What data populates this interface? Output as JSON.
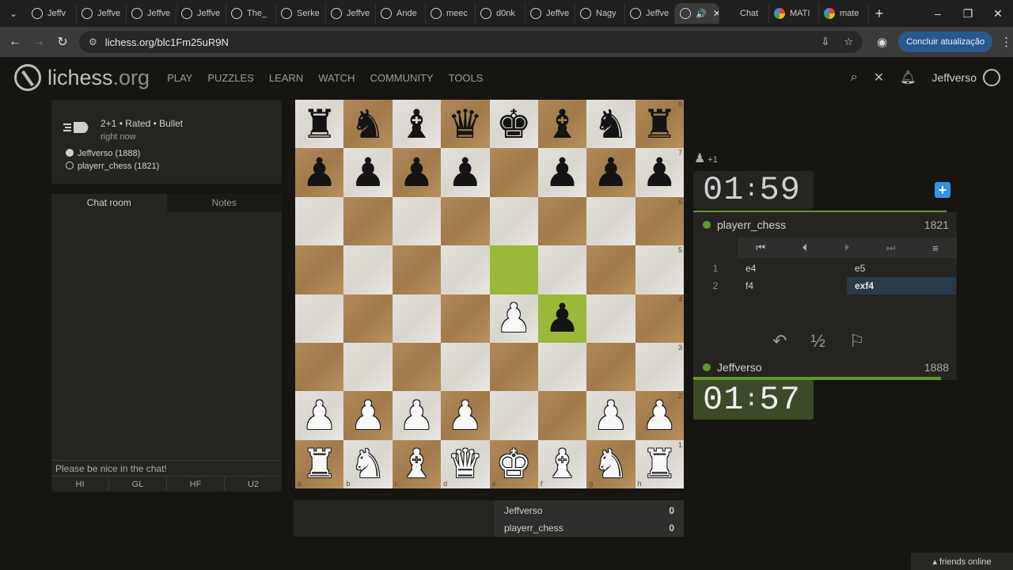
{
  "browser": {
    "tabs": [
      {
        "label": "Jeffv",
        "icon": "lichess-icon"
      },
      {
        "label": "Jeffve",
        "icon": "lichess-icon"
      },
      {
        "label": "Jeffve",
        "icon": "lichess-icon"
      },
      {
        "label": "Jeffve",
        "icon": "lichess-icon"
      },
      {
        "label": "The_",
        "icon": "lichess-icon"
      },
      {
        "label": "Serke",
        "icon": "lichess-icon"
      },
      {
        "label": "Jeffve",
        "icon": "lichess-icon"
      },
      {
        "label": "Ande",
        "icon": "lichess-icon"
      },
      {
        "label": "meec",
        "icon": "lichess-icon"
      },
      {
        "label": "d0nk",
        "icon": "lichess-icon"
      },
      {
        "label": "Jeffve",
        "icon": "lichess-icon"
      },
      {
        "label": "Nagy",
        "icon": "lichess-icon"
      },
      {
        "label": "Jeffve",
        "icon": "lichess-icon"
      }
    ],
    "extra_tabs": [
      {
        "label": "Chat",
        "icon": "chatgpt-icon"
      },
      {
        "label": "MATI",
        "icon": "google-icon"
      },
      {
        "label": "mate",
        "icon": "google-icon"
      }
    ],
    "url": "lichess.org/blc1Fm25uR9N",
    "update_label": "Concluir atualização"
  },
  "site": {
    "logo_main": "lichess",
    "logo_tld": ".org",
    "nav": [
      "PLAY",
      "PUZZLES",
      "LEARN",
      "WATCH",
      "COMMUNITY",
      "TOOLS"
    ],
    "username": "Jeffverso"
  },
  "game": {
    "mode": "2+1 • Rated • Bullet",
    "when": "right now",
    "white_player": "Jeffverso (1888)",
    "black_player": "playerr_chess (1821)"
  },
  "chat": {
    "tabs": [
      "Chat room",
      "Notes"
    ],
    "placeholder": "Please be nice in the chat!",
    "presets": [
      "HI",
      "GL",
      "HF",
      "U2"
    ]
  },
  "board": {
    "ranks": [
      "8",
      "7",
      "6",
      "5",
      "4",
      "3",
      "2",
      "1"
    ],
    "files": [
      "a",
      "b",
      "c",
      "d",
      "e",
      "f",
      "g",
      "h"
    ],
    "position": [
      [
        "r",
        "n",
        "b",
        "q",
        "k",
        "b",
        "n",
        "r"
      ],
      [
        "p",
        "p",
        "p",
        "p",
        "",
        "p",
        "p",
        "p"
      ],
      [
        "",
        "",
        "",
        "",
        "",
        "",
        "",
        ""
      ],
      [
        "",
        "",
        "",
        "",
        "",
        "",
        "",
        ""
      ],
      [
        "",
        "",
        "",
        "",
        "P",
        "p",
        "",
        ""
      ],
      [
        "",
        "",
        "",
        "",
        "",
        "",
        "",
        ""
      ],
      [
        "P",
        "P",
        "P",
        "P",
        "",
        "",
        "P",
        "P"
      ],
      [
        "R",
        "N",
        "B",
        "Q",
        "K",
        "B",
        "N",
        "R"
      ]
    ],
    "highlights": [
      "e5",
      "f4"
    ]
  },
  "clocks": {
    "material_diff": "+1",
    "top": {
      "min": "01",
      "sec": "59",
      "progress": 0.96
    },
    "bottom": {
      "min": "01",
      "sec": "57",
      "progress": 0.94
    }
  },
  "opponent": {
    "name": "playerr_chess",
    "rating": "1821"
  },
  "me": {
    "name": "Jeffverso",
    "rating": "1888"
  },
  "moves": [
    {
      "num": "1",
      "white": "e4",
      "black": "e5"
    },
    {
      "num": "2",
      "white": "f4",
      "black": "exf4"
    }
  ],
  "actions": {
    "draw": "½"
  },
  "crosstable": [
    {
      "name": "Jeffverso",
      "score": "0"
    },
    {
      "name": "playerr_chess",
      "score": "0"
    }
  ],
  "footer": {
    "friends": "▴ friends online"
  }
}
